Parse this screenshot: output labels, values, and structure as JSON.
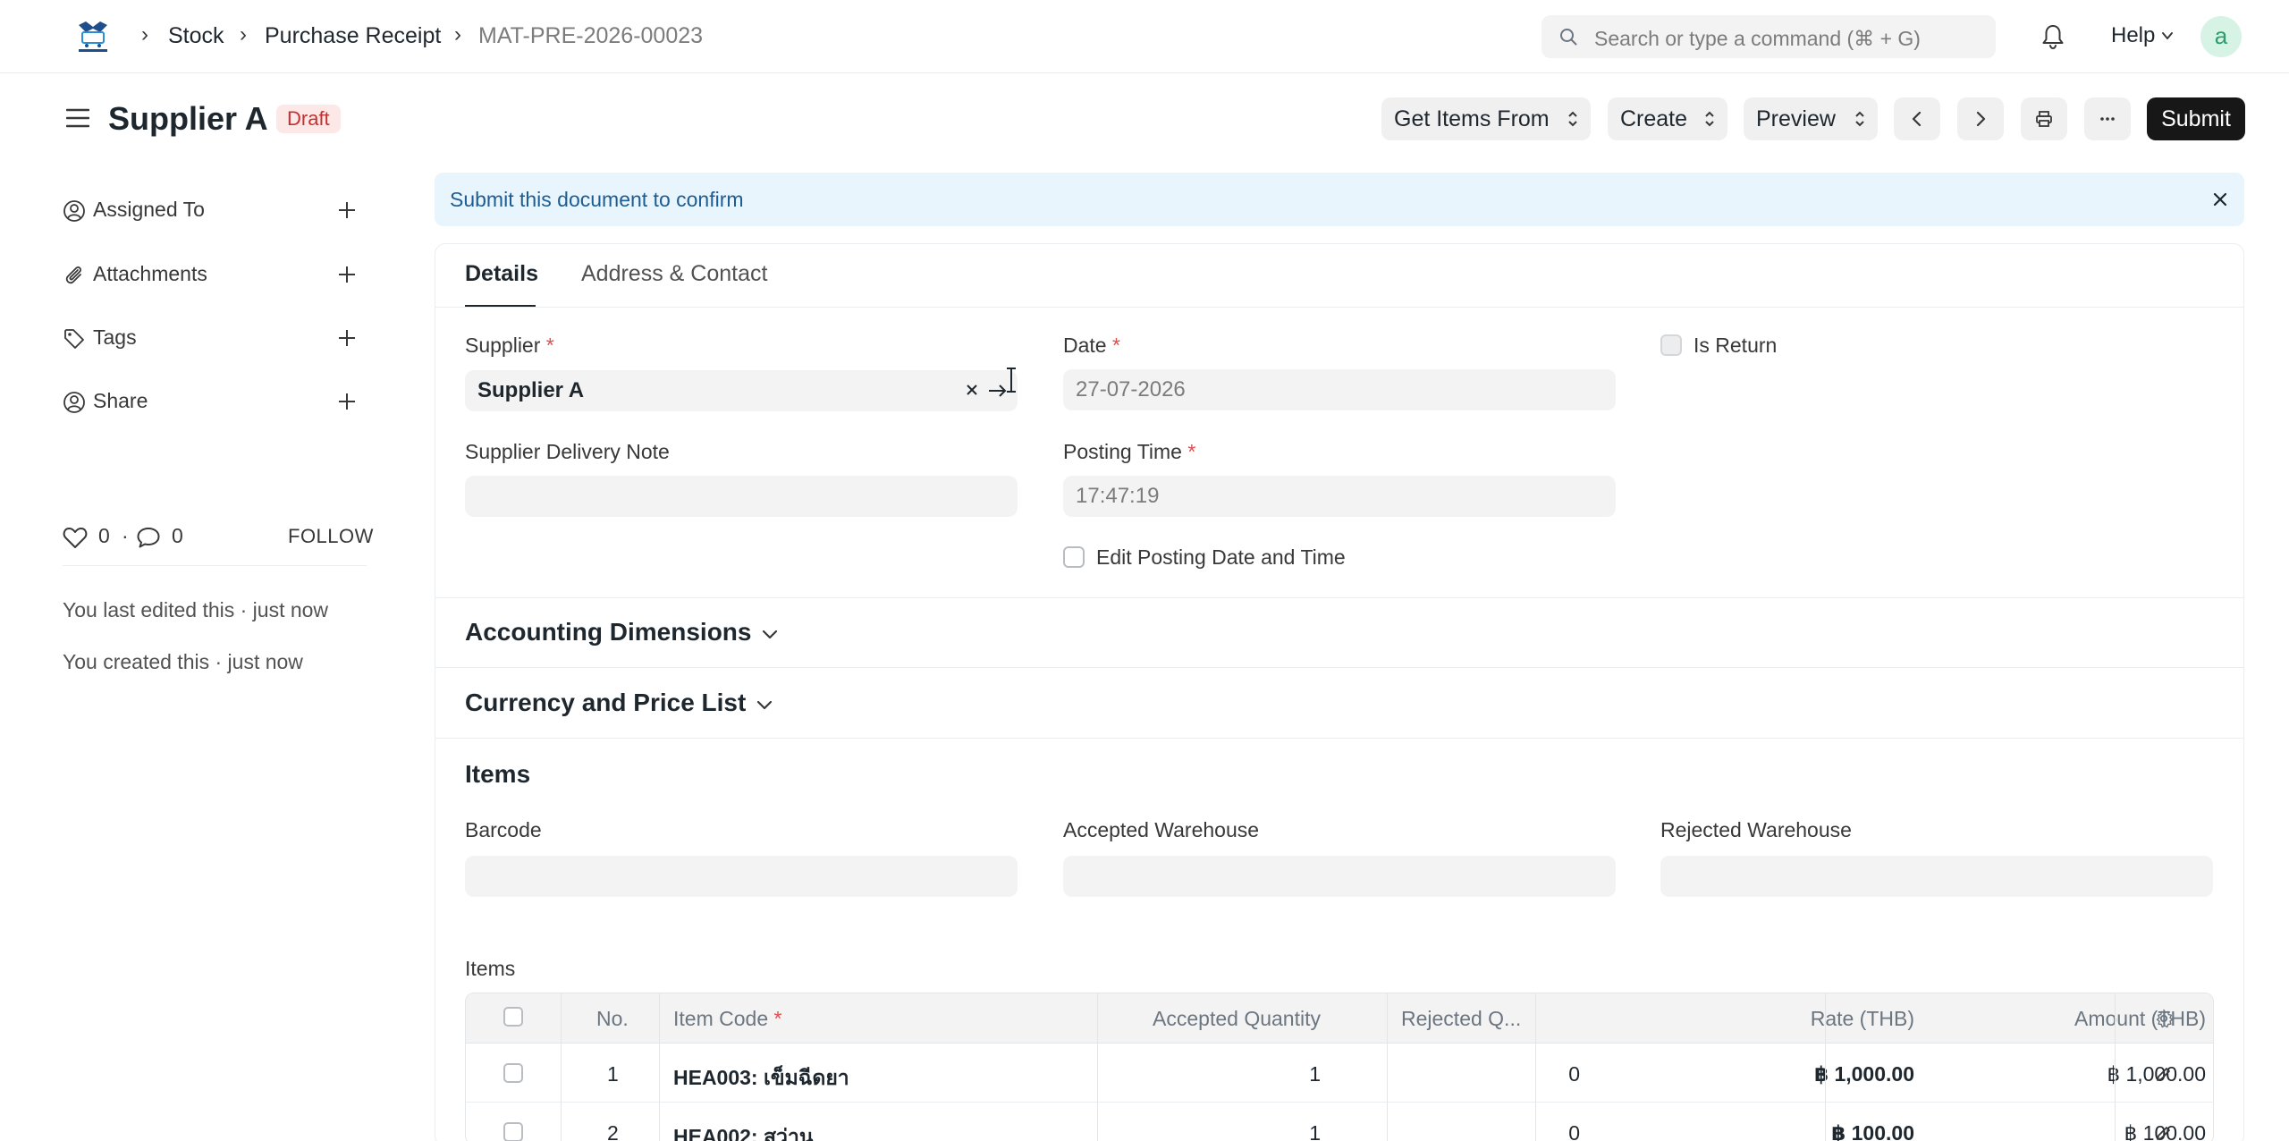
{
  "navbar": {
    "breadcrumbs": [
      "Stock",
      "Purchase Receipt",
      "MAT-PRE-2026-00023"
    ],
    "search_placeholder": "Search or type a command (⌘ + G)",
    "help_label": "Help",
    "avatar_letter": "a"
  },
  "page": {
    "title": "Supplier A",
    "status": "Draft",
    "actions": {
      "get_items_from": "Get Items From",
      "create": "Create",
      "preview": "Preview",
      "submit": "Submit"
    }
  },
  "sidebar": {
    "items": [
      {
        "label": "Assigned To",
        "icon": "assign-user-icon"
      },
      {
        "label": "Attachments",
        "icon": "paperclip-icon"
      },
      {
        "label": "Tags",
        "icon": "tag-icon"
      },
      {
        "label": "Share",
        "icon": "share-user-icon"
      }
    ],
    "likes": "0",
    "comments": "0",
    "dot": "·",
    "follow": "FOLLOW",
    "last_edited": "You last edited this · just now",
    "created": "You created this · just now"
  },
  "alert": {
    "message": "Submit this document to confirm"
  },
  "tabs": [
    "Details",
    "Address & Contact"
  ],
  "form": {
    "supplier": {
      "label": "Supplier",
      "value": "Supplier A"
    },
    "date": {
      "label": "Date",
      "value": "27-07-2026"
    },
    "is_return": {
      "label": "Is Return"
    },
    "supplier_delivery_note": {
      "label": "Supplier Delivery Note",
      "value": ""
    },
    "posting_time": {
      "label": "Posting Time",
      "value": "17:47:19"
    },
    "edit_posting": {
      "label": "Edit Posting Date and Time"
    },
    "required_mark": "*"
  },
  "sections": {
    "accounting_dimensions": "Accounting Dimensions",
    "currency_price_list": "Currency and Price List",
    "items": "Items"
  },
  "items_section": {
    "barcode_label": "Barcode",
    "accepted_warehouse_label": "Accepted Warehouse",
    "rejected_warehouse_label": "Rejected Warehouse",
    "table_label": "Items",
    "columns": {
      "no": "No.",
      "item_code": "Item Code",
      "accepted_qty": "Accepted Quantity",
      "rejected_qty": "Rejected Q...",
      "rate": "Rate (THB)",
      "amount": "Amount (THB)"
    },
    "rows": [
      {
        "no": "1",
        "item_code": "HEA003: เข็มฉีดยา",
        "accepted_qty": "1",
        "rejected_qty": "0",
        "rate": "฿ 1,000.00",
        "amount": "฿ 1,000.00"
      },
      {
        "no": "2",
        "item_code": "HEA002: สว่าน",
        "accepted_qty": "1",
        "rejected_qty": "0",
        "rate": "฿ 100.00",
        "amount": "฿ 100.00"
      }
    ]
  }
}
